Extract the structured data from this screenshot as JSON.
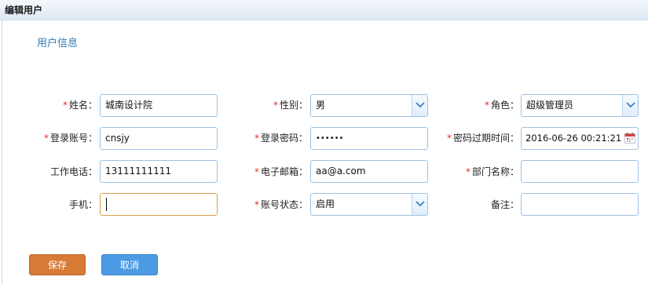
{
  "window": {
    "title": "编辑用户"
  },
  "section": {
    "title": "用户信息"
  },
  "form": {
    "name": {
      "label": "姓名：",
      "value": "城南设计院"
    },
    "gender": {
      "label": "性别：",
      "value": "男"
    },
    "role": {
      "label": "角色：",
      "value": "超级管理员"
    },
    "account": {
      "label": "登录账号：",
      "value": "cnsjy"
    },
    "password": {
      "label": "登录密码：",
      "value": "••••••"
    },
    "expire": {
      "label": "密码过期时间：",
      "value": "2016-06-26 00:21:21"
    },
    "phone": {
      "label": "工作电话：",
      "value": "13111111111"
    },
    "email": {
      "label": "电子邮箱：",
      "value": "aa@a.com"
    },
    "dept": {
      "label": "部门名称：",
      "value": ""
    },
    "mobile": {
      "label": "手机：",
      "value": ""
    },
    "status": {
      "label": "账号状态：",
      "value": "启用"
    },
    "remark": {
      "label": "备注：",
      "value": ""
    },
    "required_mark": "*"
  },
  "buttons": {
    "save": "保存",
    "cancel": "取消"
  },
  "colors": {
    "accent": "#2e7ab7",
    "required": "#e0302b",
    "save": "#d77a35",
    "cancel": "#4b9ae3"
  }
}
